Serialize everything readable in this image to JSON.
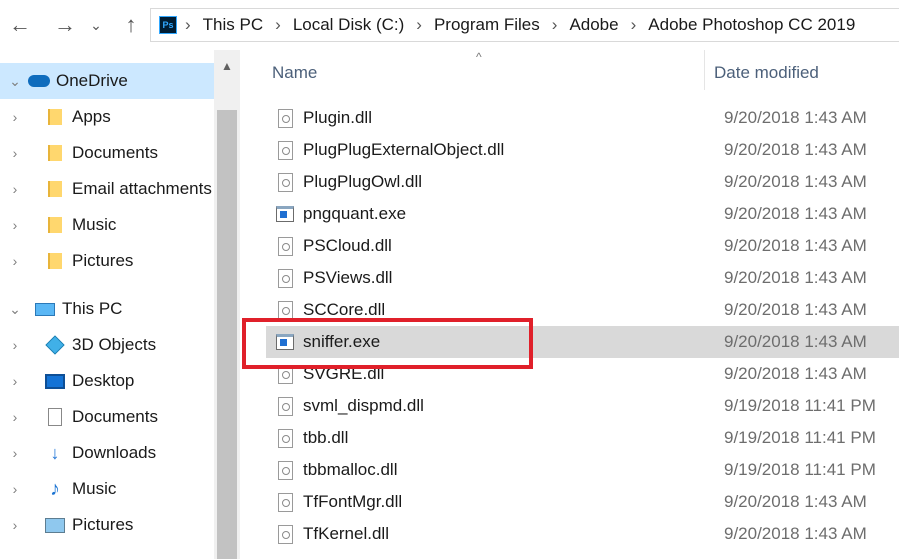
{
  "address_bar": {
    "crumbs": [
      "This PC",
      "Local Disk (C:)",
      "Program Files",
      "Adobe",
      "Adobe Photoshop CC 2019"
    ],
    "path_icon_label": "Ps"
  },
  "nav": {
    "back_glyph": "←",
    "forward_glyph": "→",
    "recent_glyph": "⌄",
    "up_glyph": "↑"
  },
  "sidebar": {
    "items": [
      {
        "label": "OneDrive",
        "icon": "onedrive-cloud-icon",
        "expanded": true
      },
      {
        "label": "Apps",
        "icon": "folder-icon"
      },
      {
        "label": "Documents",
        "icon": "folder-icon"
      },
      {
        "label": "Email attachments",
        "icon": "folder-icon"
      },
      {
        "label": "Music",
        "icon": "folder-icon"
      },
      {
        "label": "Pictures",
        "icon": "folder-icon"
      },
      {
        "label": "This PC",
        "icon": "computer-icon",
        "expanded": true
      },
      {
        "label": "3D Objects",
        "icon": "3d-objects-icon"
      },
      {
        "label": "Desktop",
        "icon": "desktop-icon"
      },
      {
        "label": "Documents",
        "icon": "documents-icon"
      },
      {
        "label": "Downloads",
        "icon": "downloads-icon"
      },
      {
        "label": "Music",
        "icon": "music-icon"
      },
      {
        "label": "Pictures",
        "icon": "pictures-icon"
      }
    ]
  },
  "file_list": {
    "columns": {
      "name": "Name",
      "date_modified": "Date modified"
    },
    "files": [
      {
        "name": "Plugin.dll",
        "type": "dll",
        "date": "9/20/2018 1:43 AM"
      },
      {
        "name": "PlugPlugExternalObject.dll",
        "type": "dll",
        "date": "9/20/2018 1:43 AM"
      },
      {
        "name": "PlugPlugOwl.dll",
        "type": "dll",
        "date": "9/20/2018 1:43 AM"
      },
      {
        "name": "pngquant.exe",
        "type": "exe",
        "date": "9/20/2018 1:43 AM"
      },
      {
        "name": "PSCloud.dll",
        "type": "dll",
        "date": "9/20/2018 1:43 AM"
      },
      {
        "name": "PSViews.dll",
        "type": "dll",
        "date": "9/20/2018 1:43 AM"
      },
      {
        "name": "SCCore.dll",
        "type": "dll",
        "date": "9/20/2018 1:43 AM"
      },
      {
        "name": "sniffer.exe",
        "type": "exe",
        "date": "9/20/2018 1:43 AM",
        "highlighted": true
      },
      {
        "name": "SVGRE.dll",
        "type": "dll",
        "date": "9/20/2018 1:43 AM"
      },
      {
        "name": "svml_dispmd.dll",
        "type": "dll",
        "date": "9/19/2018 11:41 PM"
      },
      {
        "name": "tbb.dll",
        "type": "dll",
        "date": "9/19/2018 11:41 PM"
      },
      {
        "name": "tbbmalloc.dll",
        "type": "dll",
        "date": "9/19/2018 11:41 PM"
      },
      {
        "name": "TfFontMgr.dll",
        "type": "dll",
        "date": "9/20/2018 1:43 AM"
      },
      {
        "name": "TfKernel.dll",
        "type": "dll",
        "date": "9/20/2018 1:43 AM"
      }
    ]
  },
  "colors": {
    "selection": "#cce8ff",
    "row_highlight": "#d9d9d9",
    "annotation_box": "#e0202a",
    "header_text": "#4c607a"
  }
}
